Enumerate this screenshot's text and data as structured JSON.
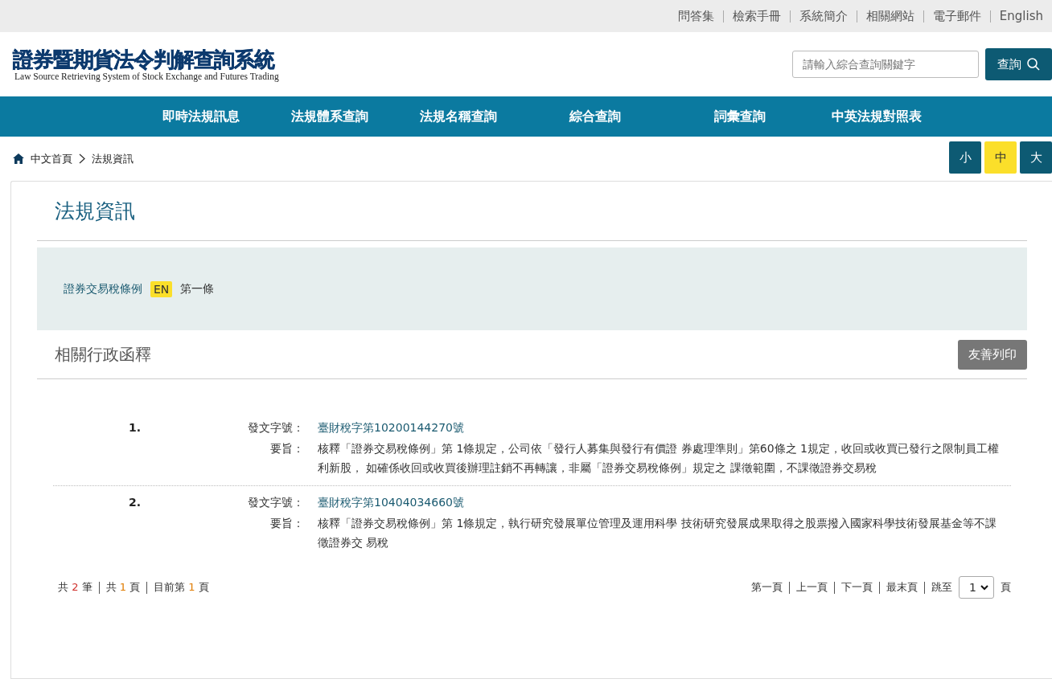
{
  "top_links": [
    "問答集",
    "檢索手冊",
    "系統簡介",
    "相關網站",
    "電子郵件",
    "English"
  ],
  "header": {
    "title": "證券暨期貨法令判解查詢系統",
    "subtitle": "Law Source Retrieving System of Stock Exchange and Futures Trading",
    "search": {
      "placeholder": "請輸入綜合查詢關鍵字"
    },
    "search_button": "查詢"
  },
  "nav": [
    "即時法規訊息",
    "法規體系查詢",
    "法規名稱查詢",
    "綜合查詢",
    "詞彙查詢",
    "中英法規對照表"
  ],
  "breadcrumb": [
    "中文首頁",
    "法規資訊"
  ],
  "font_sizes": [
    {
      "label": "小",
      "selected": false
    },
    {
      "label": "中",
      "selected": true
    },
    {
      "label": "大",
      "selected": false
    }
  ],
  "page_title": "法規資訊",
  "law": {
    "name": "證券交易稅條例",
    "badge": "EN",
    "article": "第一條"
  },
  "section_title": "相關行政函釋",
  "print_button": "友善列印",
  "entries": [
    {
      "number": "1.",
      "doc_label": "發文字號：",
      "doc_no": "臺財稅字第10200144270號",
      "summary_label": "要旨：",
      "summary": "核釋「證券交易稅條例」第 1條規定，公司依「發行人募集與發行有價證 券處理準則」第60條之 1規定，收回或收買已發行之限制員工權利新股， 如確係收回或收買後辦理註銷不再轉讓，非屬「證券交易稅條例」規定之 課徵範圍，不課徵證券交易稅"
    },
    {
      "number": "2.",
      "doc_label": "發文字號：",
      "doc_no": "臺財稅字第10404034660號",
      "summary_label": "要旨：",
      "summary": "核釋「證券交易稅條例」第 1條規定，執行研究發展單位管理及運用科學 技術研究發展成果取得之股票撥入國家科學技術發展基金等不課徵證券交 易稅"
    }
  ],
  "summary": [
    {
      "before": "共",
      "count": "2",
      "after": "筆",
      "color": "#d0312d"
    },
    {
      "before": "共",
      "count": "1",
      "after": "頁",
      "color": "#e07b00"
    },
    {
      "before": "目前第",
      "count": "1",
      "after": "頁",
      "color": "#e07b00"
    }
  ],
  "pager": {
    "links": [
      "第一頁",
      "上一頁",
      "下一頁",
      "最末頁"
    ],
    "jump_label": "跳至",
    "page_value": "1",
    "page_suffix": "頁"
  }
}
